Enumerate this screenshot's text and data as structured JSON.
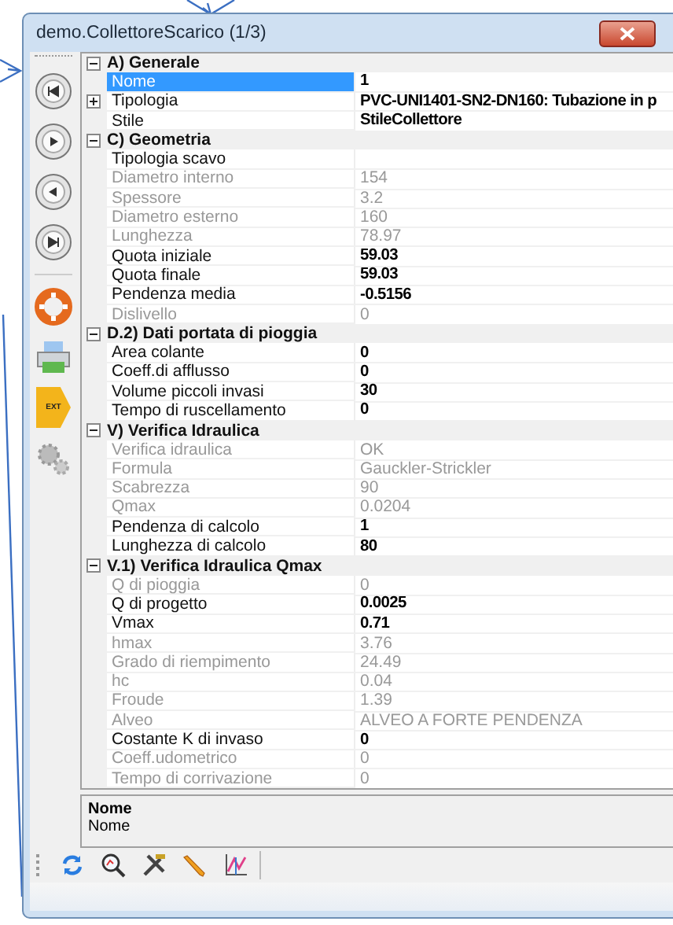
{
  "window": {
    "title": "demo.CollettoreScarico (1/3)"
  },
  "side_toolbar": [
    {
      "kind": "first"
    },
    {
      "kind": "next"
    },
    {
      "kind": "prev"
    },
    {
      "kind": "last"
    },
    {
      "kind": "help"
    },
    {
      "kind": "print"
    },
    {
      "kind": "tag",
      "label": "EXT"
    },
    {
      "kind": "gears"
    }
  ],
  "categories": [
    {
      "title": "A) Generale",
      "expanded": true,
      "rows": [
        {
          "label": "Nome",
          "value": "1",
          "readonly": false,
          "selected": true
        },
        {
          "label": "Tipologia",
          "value": "PVC-UNI1401-SN2-DN160: Tubazione in p",
          "readonly": false,
          "selected": false,
          "expandable": true
        },
        {
          "label": "Stile",
          "value": "StileCollettore",
          "readonly": false,
          "selected": false
        }
      ]
    },
    {
      "title": "C) Geometria",
      "expanded": true,
      "rows": [
        {
          "label": "Tipologia scavo",
          "value": "",
          "readonly": false,
          "selected": false
        },
        {
          "label": "Diametro interno",
          "value": "154",
          "readonly": true,
          "selected": false
        },
        {
          "label": "Spessore",
          "value": "3.2",
          "readonly": true,
          "selected": false
        },
        {
          "label": "Diametro esterno",
          "value": "160",
          "readonly": true,
          "selected": false
        },
        {
          "label": "Lunghezza",
          "value": "78.97",
          "readonly": true,
          "selected": false
        },
        {
          "label": "Quota iniziale",
          "value": "59.03",
          "readonly": false,
          "selected": false
        },
        {
          "label": "Quota finale",
          "value": "59.03",
          "readonly": false,
          "selected": false
        },
        {
          "label": "Pendenza media",
          "value": "-0.5156",
          "readonly": false,
          "selected": false
        },
        {
          "label": "Dislivello",
          "value": "0",
          "readonly": true,
          "selected": false
        }
      ]
    },
    {
      "title": "D.2) Dati portata di pioggia",
      "expanded": true,
      "rows": [
        {
          "label": "Area colante",
          "value": "0",
          "readonly": false,
          "selected": false
        },
        {
          "label": "Coeff.di afflusso",
          "value": "0",
          "readonly": false,
          "selected": false
        },
        {
          "label": "Volume piccoli invasi",
          "value": "30",
          "readonly": false,
          "selected": false
        },
        {
          "label": "Tempo di ruscellamento",
          "value": "0",
          "readonly": false,
          "selected": false
        }
      ]
    },
    {
      "title": "V) Verifica Idraulica",
      "expanded": true,
      "rows": [
        {
          "label": "Verifica idraulica",
          "value": "OK",
          "readonly": true,
          "selected": false
        },
        {
          "label": "Formula",
          "value": "Gauckler-Strickler",
          "readonly": true,
          "selected": false
        },
        {
          "label": "Scabrezza",
          "value": "90",
          "readonly": true,
          "selected": false
        },
        {
          "label": "Qmax",
          "value": "0.0204",
          "readonly": true,
          "selected": false
        },
        {
          "label": "Pendenza di calcolo",
          "value": "1",
          "readonly": false,
          "selected": false
        },
        {
          "label": "Lunghezza di calcolo",
          "value": "80",
          "readonly": false,
          "selected": false
        }
      ]
    },
    {
      "title": "V.1) Verifica Idraulica Qmax",
      "expanded": true,
      "rows": [
        {
          "label": "Q di pioggia",
          "value": "0",
          "readonly": true,
          "selected": false
        },
        {
          "label": "Q di progetto",
          "value": "0.0025",
          "readonly": false,
          "selected": false
        },
        {
          "label": "Vmax",
          "value": "0.71",
          "readonly": false,
          "selected": false
        },
        {
          "label": "hmax",
          "value": "3.76",
          "readonly": true,
          "selected": false
        },
        {
          "label": "Grado di riempimento",
          "value": "24.49",
          "readonly": true,
          "selected": false
        },
        {
          "label": "hc",
          "value": "0.04",
          "readonly": true,
          "selected": false
        },
        {
          "label": "Froude",
          "value": "1.39",
          "readonly": true,
          "selected": false
        },
        {
          "label": "Alveo",
          "value": "ALVEO A FORTE PENDENZA",
          "readonly": true,
          "selected": false
        },
        {
          "label": "Costante K di invaso",
          "value": "0",
          "readonly": false,
          "selected": false
        },
        {
          "label": "Coeff.udometrico",
          "value": "0",
          "readonly": true,
          "selected": false
        },
        {
          "label": "Tempo di corrivazione",
          "value": "0",
          "readonly": true,
          "selected": false
        }
      ]
    }
  ],
  "description": {
    "title": "Nome",
    "text": "Nome"
  },
  "bottom_toolbar": [
    {
      "kind": "refresh"
    },
    {
      "kind": "zoom"
    },
    {
      "kind": "tools"
    },
    {
      "kind": "pencil"
    },
    {
      "kind": "chart"
    }
  ]
}
